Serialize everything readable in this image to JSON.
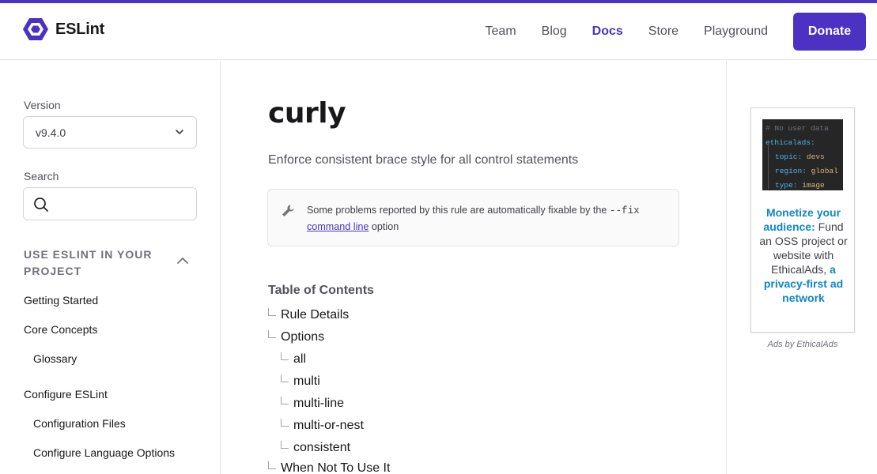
{
  "header": {
    "brand": "ESLint",
    "nav": [
      {
        "label": "Team",
        "active": false
      },
      {
        "label": "Blog",
        "active": false
      },
      {
        "label": "Docs",
        "active": true
      },
      {
        "label": "Store",
        "active": false
      },
      {
        "label": "Playground",
        "active": false
      }
    ],
    "donate_label": "Donate"
  },
  "sidebar": {
    "version_label": "Version",
    "version_value": "v9.4.0",
    "search_label": "Search",
    "search_placeholder": "",
    "section_title": "USE ESLINT IN YOUR PROJECT",
    "items": [
      {
        "label": "Getting Started",
        "level": 1
      },
      {
        "label": "Core Concepts",
        "level": 1
      },
      {
        "label": "Glossary",
        "level": 2
      },
      {
        "label": "Configure ESLint",
        "level": 1
      },
      {
        "label": "Configuration Files",
        "level": 2
      },
      {
        "label": "Configure Language Options",
        "level": 2
      }
    ]
  },
  "main": {
    "title": "curly",
    "lede": "Enforce consistent brace style for all control statements",
    "fix_note": {
      "before": "Some problems reported by this rule are automatically fixable by the ",
      "code": "--fix",
      "link": "command line",
      "after": " option"
    },
    "toc": {
      "title": "Table of Contents",
      "items": [
        {
          "label": "Rule Details",
          "level": 1
        },
        {
          "label": "Options",
          "level": 1
        },
        {
          "label": "all",
          "level": 2
        },
        {
          "label": "multi",
          "level": 2
        },
        {
          "label": "multi-line",
          "level": 2
        },
        {
          "label": "multi-or-nest",
          "level": 2
        },
        {
          "label": "consistent",
          "level": 2
        },
        {
          "label": "When Not To Use It",
          "level": 1
        }
      ]
    }
  },
  "ad": {
    "code_lines": {
      "comment": "# No user data",
      "key": "ethicalads:",
      "topic_k": "topic:",
      "topic_v": "devs",
      "region_k": "region:",
      "region_v": "global",
      "type_k": "type:",
      "type_v": "image"
    },
    "headline": "Monetize your audience:",
    "body": "Fund an OSS project or website with EthicalAds,",
    "link": "a privacy-first ad network",
    "byline": "Ads by EthicalAds"
  },
  "colors": {
    "brand": "#4b32c3",
    "ad_link": "#0f86c7"
  }
}
